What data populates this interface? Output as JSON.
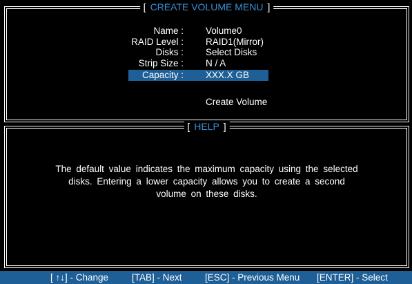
{
  "menu": {
    "title": "CREATE VOLUME MENU",
    "bracket_open": "[",
    "bracket_close": "]",
    "fields": [
      {
        "label": "Name :",
        "value": "Volume0"
      },
      {
        "label": "RAID Level :",
        "value": "RAID1(Mirror)"
      },
      {
        "label": "Disks :",
        "value": "Select  Disks"
      },
      {
        "label": "Strip Size :",
        "value": "N / A"
      },
      {
        "label": "Capacity :",
        "value": "XXX.X  GB"
      }
    ],
    "action": "Create Volume"
  },
  "help": {
    "title": "HELP",
    "bracket_open": "[",
    "bracket_close": "]",
    "lines": [
      "The default value indicates the maximum capacity using the selected",
      "disks. Entering a lower capacity allows you to create a second",
      "volume on these disks."
    ]
  },
  "statusbar": {
    "change": "[ ↑↓] - Change",
    "next": "[TAB] - Next",
    "previous": "[ESC] - Previous Menu",
    "select": "[ENTER] - Select"
  },
  "colors": {
    "accent": "#3a8fd4",
    "highlight": "#1d5f96",
    "background": "#000000",
    "text": "#ffffff"
  }
}
